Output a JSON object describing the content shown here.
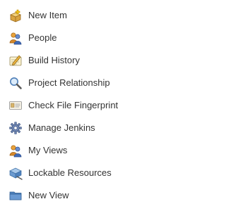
{
  "tasks": [
    {
      "label": "New Item",
      "icon": "new-item-icon"
    },
    {
      "label": "People",
      "icon": "people-icon"
    },
    {
      "label": "Build History",
      "icon": "build-history-icon"
    },
    {
      "label": "Project Relationship",
      "icon": "magnifier-icon"
    },
    {
      "label": "Check File Fingerprint",
      "icon": "fingerprint-card-icon"
    },
    {
      "label": "Manage Jenkins",
      "icon": "gear-icon"
    },
    {
      "label": "My Views",
      "icon": "my-views-icon"
    },
    {
      "label": "Lockable Resources",
      "icon": "lock-resources-icon"
    },
    {
      "label": "New View",
      "icon": "folder-icon"
    }
  ]
}
